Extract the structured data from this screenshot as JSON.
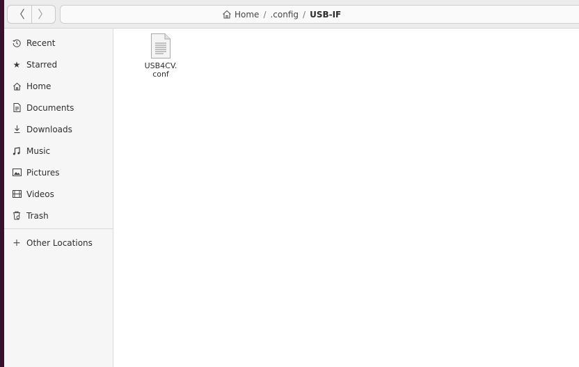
{
  "header": {
    "back_glyph": "〈",
    "forward_glyph": "〉",
    "breadcrumbs": {
      "home": "Home",
      "sep1": "/",
      "config": ".config",
      "sep2": "/",
      "current": "USB-IF"
    }
  },
  "sidebar": {
    "items": [
      {
        "label": "Recent",
        "icon": "clock-icon"
      },
      {
        "label": "Starred",
        "icon": "star-icon"
      },
      {
        "label": "Home",
        "icon": "home-icon"
      },
      {
        "label": "Documents",
        "icon": "document-icon"
      },
      {
        "label": "Downloads",
        "icon": "download-icon"
      },
      {
        "label": "Music",
        "icon": "music-icon"
      },
      {
        "label": "Pictures",
        "icon": "picture-icon"
      },
      {
        "label": "Videos",
        "icon": "video-icon"
      },
      {
        "label": "Trash",
        "icon": "trash-icon"
      },
      {
        "label": "Other Locations",
        "icon": "plus-icon"
      }
    ]
  },
  "main": {
    "files": [
      {
        "name_line1": "USB4CV.",
        "name_line2": "conf",
        "icon": "text-file-icon"
      }
    ]
  }
}
